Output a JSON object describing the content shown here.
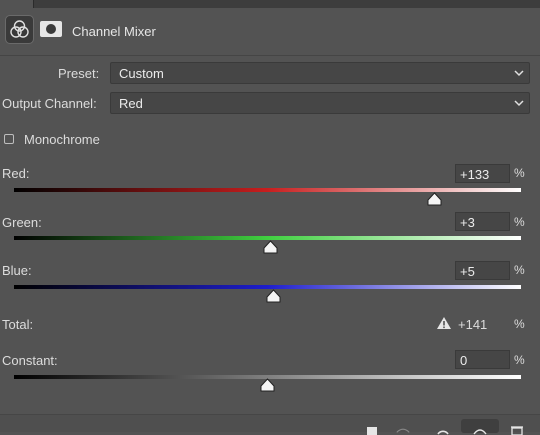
{
  "header": {
    "title": "Channel Mixer",
    "adjustment_icon": "channel-mixer-icon",
    "mask_icon": "layer-mask-icon"
  },
  "preset": {
    "label": "Preset:",
    "value": "Custom"
  },
  "output_channel": {
    "label": "Output Channel:",
    "value": "Red"
  },
  "monochrome": {
    "label": "Monochrome",
    "checked": false
  },
  "sliders": {
    "red": {
      "label": "Red:",
      "value": "+133",
      "unit": "%",
      "fraction": 0.83
    },
    "green": {
      "label": "Green:",
      "value": "+3",
      "unit": "%",
      "fraction": 0.505
    },
    "blue": {
      "label": "Blue:",
      "value": "+5",
      "unit": "%",
      "fraction": 0.511
    },
    "constant": {
      "label": "Constant:",
      "value": "0",
      "unit": "%",
      "fraction": 0.5
    }
  },
  "total": {
    "label": "Total:",
    "value": "+141",
    "unit": "%",
    "warning_icon": "warning-icon"
  },
  "colors": {
    "red": "#ff3b30",
    "green": "#33cc33",
    "blue": "#2a2aff",
    "background": "#535353"
  },
  "footer_icons": [
    "clip-to-layer-icon",
    "visibility-icon",
    "reset-icon",
    "toggle-visibility-icon",
    "trash-icon"
  ]
}
